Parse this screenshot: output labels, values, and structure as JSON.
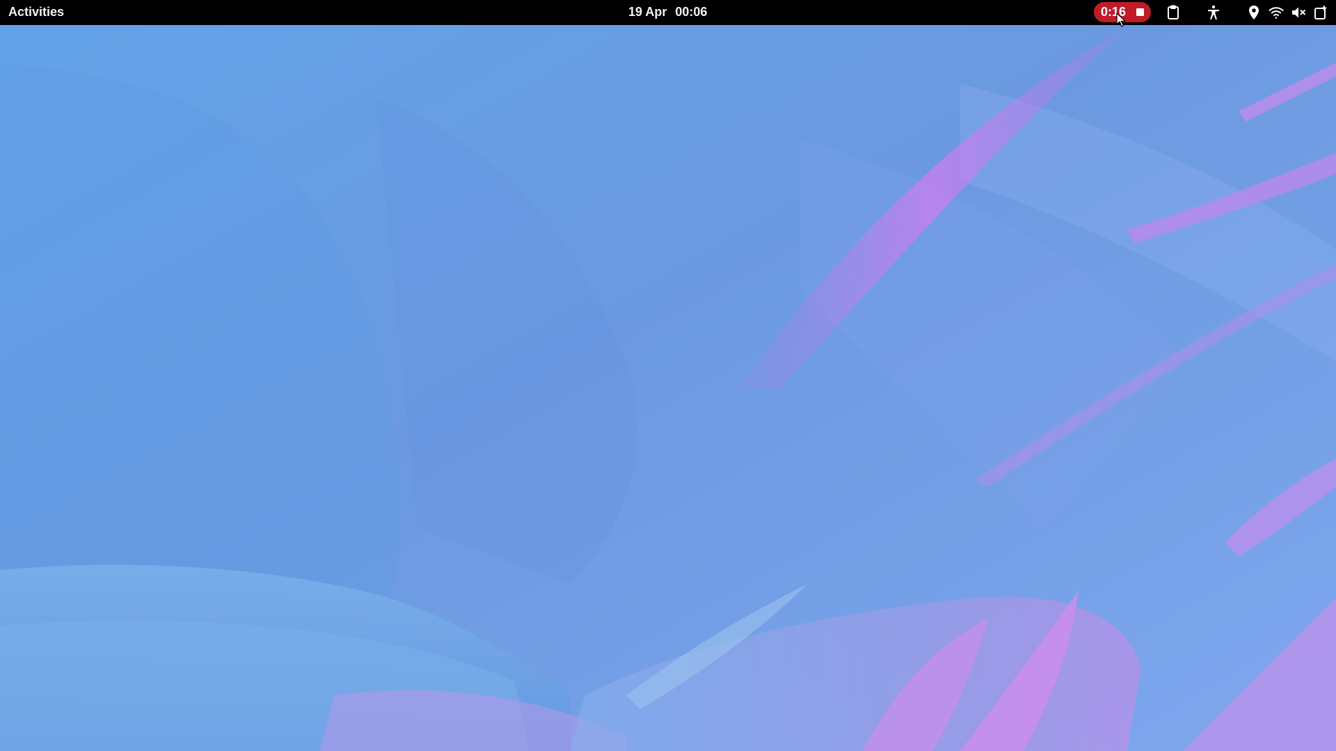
{
  "top_bar": {
    "activities_label": "Activities",
    "clock": {
      "date": "19 Apr",
      "time": "00:06"
    },
    "recording": {
      "elapsed": "0:16",
      "color": "#c01c28"
    },
    "tray_icons": [
      "clipboard-icon",
      "accessibility-icon",
      "location-icon",
      "wifi-icon",
      "volume-muted-icon",
      "power-icon"
    ]
  },
  "wallpaper": {
    "base_color": "#6d9ee3",
    "accent_color": "#c07ae8"
  }
}
